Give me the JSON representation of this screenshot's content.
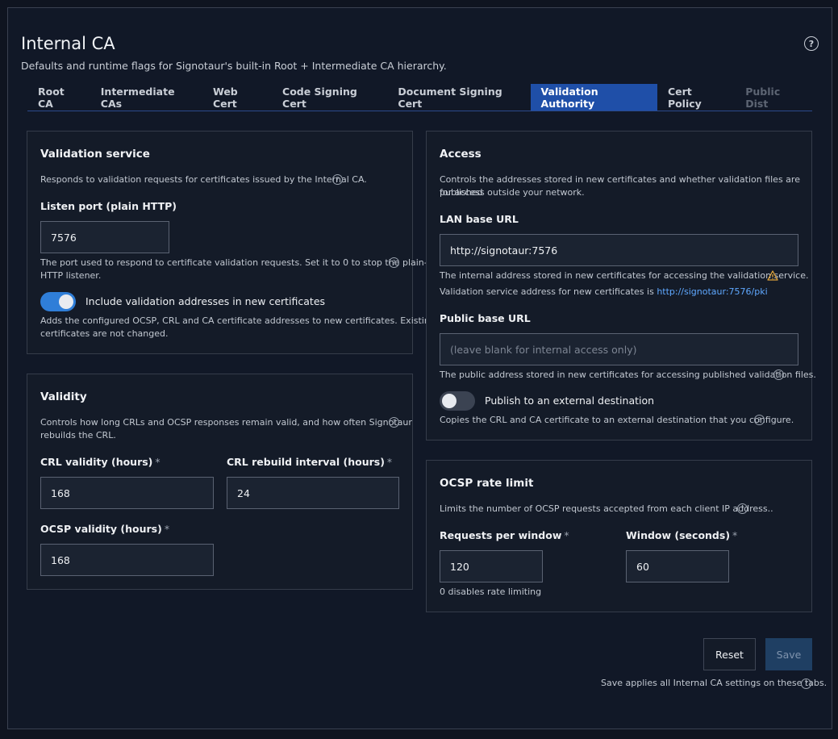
{
  "header": {
    "title": "Internal CA",
    "subtitle": "Defaults and runtime flags for Signotaur's built-in Root + Intermediate CA hierarchy.",
    "help_glyph": "?"
  },
  "tabs": [
    {
      "label": "Root CA",
      "state": "normal"
    },
    {
      "label": "Intermediate CAs",
      "state": "normal"
    },
    {
      "label": "Web Cert",
      "state": "normal"
    },
    {
      "label": "Code Signing Cert",
      "state": "normal"
    },
    {
      "label": "Document Signing Cert",
      "state": "normal"
    },
    {
      "label": "Validation Authority",
      "state": "active"
    },
    {
      "label": "Cert Policy",
      "state": "normal"
    },
    {
      "label": "Public Dist",
      "state": "disabled"
    }
  ],
  "validation_service": {
    "title": "Validation service",
    "description": "Responds to validation requests for certificates issued by the Internal CA.",
    "port_label": "Listen port (plain HTTP)",
    "port_value": "7576",
    "port_help_line1": "The port used to respond to certificate validation requests. Set it to 0 to stop the plain-",
    "port_help_line2": "HTTP listener.",
    "include_toggle_label": "Include validation addresses in new certificates",
    "include_toggle_on": true,
    "include_help_line1": "Adds the configured OCSP, CRL and CA certificate addresses to new certificates. Existing",
    "include_help_line2": "certificates are not changed."
  },
  "validity": {
    "title": "Validity",
    "description_line1": "Controls how long CRLs and OCSP responses remain valid, and how often Signotaur",
    "description_line2": "rebuilds the CRL.",
    "crl_validity_label": "CRL validity (hours)",
    "crl_validity_value": "168",
    "crl_rebuild_label": "CRL rebuild interval (hours)",
    "crl_rebuild_value": "24",
    "ocsp_validity_label": "OCSP validity (hours)",
    "ocsp_validity_value": "168",
    "required_mark": "*"
  },
  "access": {
    "title": "Access",
    "description_line1": "Controls the addresses stored in new certificates and whether validation files are published",
    "description_line2": "for access outside your network.",
    "lan_label": "LAN base URL",
    "lan_value": "http://signotaur:7576",
    "lan_help": "The internal address stored in new certificates for accessing the validation service.",
    "service_address_prefix": "Validation service address for new certificates is",
    "service_address_link": "http://signotaur:7576/pki",
    "public_label": "Public base URL",
    "public_placeholder": "(leave blank for internal access only)",
    "public_help": "The public address stored in new certificates for accessing published validation files.",
    "publish_toggle_label": "Publish to an external destination",
    "publish_toggle_on": false,
    "publish_help": "Copies the CRL and CA certificate to an external destination that you configure."
  },
  "ocsp_rate": {
    "title": "OCSP rate limit",
    "description": "Limits the number of OCSP requests accepted from each client IP address..",
    "requests_label": "Requests per window",
    "requests_value": "120",
    "window_label": "Window (seconds)",
    "window_value": "60",
    "requests_help": "0 disables rate limiting"
  },
  "footer": {
    "reset_label": "Reset",
    "save_label": "Save",
    "note": "Save applies all Internal CA settings on these tabs."
  },
  "colors": {
    "accent": "#1f4fa8",
    "toggle_on": "#2f7ed8",
    "link": "#5fa8ff",
    "warning": "#e0a43a"
  }
}
